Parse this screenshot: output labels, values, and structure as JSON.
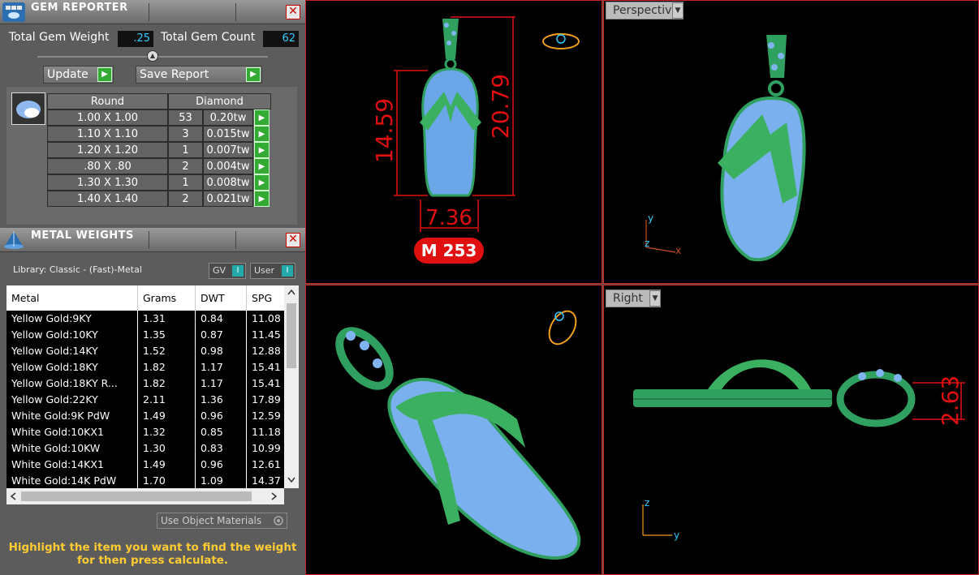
{
  "gem_reporter": {
    "title": "GEM REPORTER",
    "total_gem_weight_label": "Total Gem Weight",
    "total_gem_weight": ".25",
    "total_gem_count_label": "Total Gem Count",
    "total_gem_count": "62",
    "update_label": "Update",
    "save_report_label": "Save Report",
    "header_shape": "Round",
    "header_material": "Diamond",
    "rows": [
      {
        "size": "1.00 X 1.00",
        "count": "53",
        "weight": "0.20tw"
      },
      {
        "size": "1.10 X 1.10",
        "count": "3",
        "weight": "0.015tw"
      },
      {
        "size": "1.20 X 1.20",
        "count": "1",
        "weight": "0.007tw"
      },
      {
        "size": ".80 X .80",
        "count": "2",
        "weight": "0.004tw"
      },
      {
        "size": "1.30 X 1.30",
        "count": "1",
        "weight": "0.008tw"
      },
      {
        "size": "1.40 X 1.40",
        "count": "2",
        "weight": "0.021tw"
      }
    ]
  },
  "metal_weights": {
    "title": "METAL WEIGHTS",
    "library": "Library: Classic - (Fast)-Metal",
    "gv_label": "GV",
    "user_label": "User",
    "columns": [
      "Metal",
      "Grams",
      "DWT",
      "SPG"
    ],
    "rows": [
      [
        "Yellow Gold:9KY",
        "1.31",
        "0.84",
        "11.08"
      ],
      [
        "Yellow Gold:10KY",
        "1.35",
        "0.87",
        "11.45"
      ],
      [
        "Yellow Gold:14KY",
        "1.52",
        "0.98",
        "12.88"
      ],
      [
        "Yellow Gold:18KY",
        "1.82",
        "1.17",
        "15.41"
      ],
      [
        "Yellow Gold:18KY R...",
        "1.82",
        "1.17",
        "15.41"
      ],
      [
        "Yellow Gold:22KY",
        "2.11",
        "1.36",
        "17.89"
      ],
      [
        "White Gold:9K PdW",
        "1.49",
        "0.96",
        "12.59"
      ],
      [
        "White Gold:10KX1",
        "1.32",
        "0.85",
        "11.18"
      ],
      [
        "White Gold:10KW",
        "1.30",
        "0.83",
        "10.99"
      ],
      [
        "White Gold:14KX1",
        "1.49",
        "0.96",
        "12.61"
      ],
      [
        "White Gold:14K PdW",
        "1.70",
        "1.09",
        "14.37"
      ]
    ],
    "use_object_materials": "Use Object Materials",
    "hint": "Highlight the item you want to find the weight for then press calculate."
  },
  "viewports": {
    "top_left": {
      "dim_height": "20.79",
      "dim_side": "14.59",
      "dim_width": "7.36",
      "badge": "M 253"
    },
    "top_right": {
      "label": "Perspective",
      "axis_x": "x",
      "axis_y": "y",
      "axis_z": "z"
    },
    "bottom_right": {
      "label": "Right",
      "dim": "2.63",
      "axis_z": "z",
      "axis_y": "y"
    }
  },
  "colors": {
    "accent_red": "#e01010",
    "model_green": "#2fa060",
    "stone_blue": "#7fb4f0"
  }
}
